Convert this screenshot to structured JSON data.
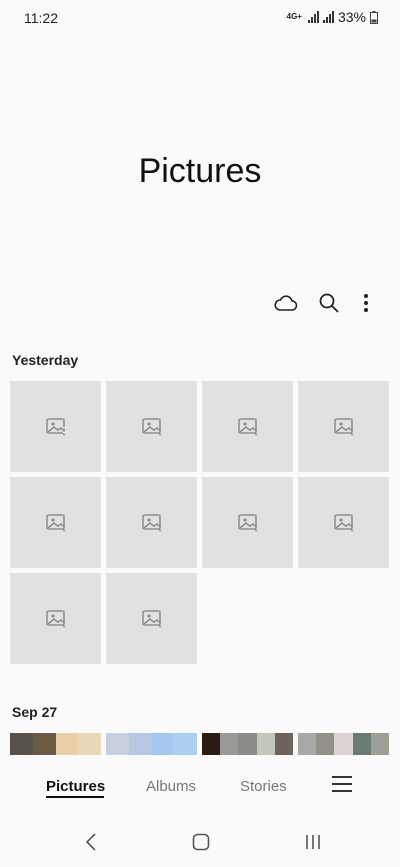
{
  "status": {
    "time": "11:22",
    "network": "4G+",
    "battery": "33%"
  },
  "title": "Pictures",
  "toolbar": {
    "icons": [
      "cloud-icon",
      "search-icon",
      "more-options-icon"
    ]
  },
  "sections": [
    {
      "label": "Yesterday",
      "item_count": 10
    },
    {
      "label": "Sep 27"
    }
  ],
  "tabs": [
    "Pictures",
    "Albums",
    "Stories"
  ],
  "active_tab": "Pictures",
  "strip_colors": [
    [
      "#57534b",
      "#6d5a45",
      "#e8cfa6",
      "#e9d9b8"
    ],
    [
      "#c9cfdf",
      "#b8c8e4",
      "#a6c8ee",
      "#acd0f0"
    ],
    [
      "#2b1b15",
      "#9a9a98",
      "#8a8a86",
      "#c0c7bd",
      "#6f625a"
    ],
    [
      "#a9a8a8",
      "#939088",
      "#dbd4d2",
      "#6b7a72",
      "#9c9f95"
    ]
  ]
}
